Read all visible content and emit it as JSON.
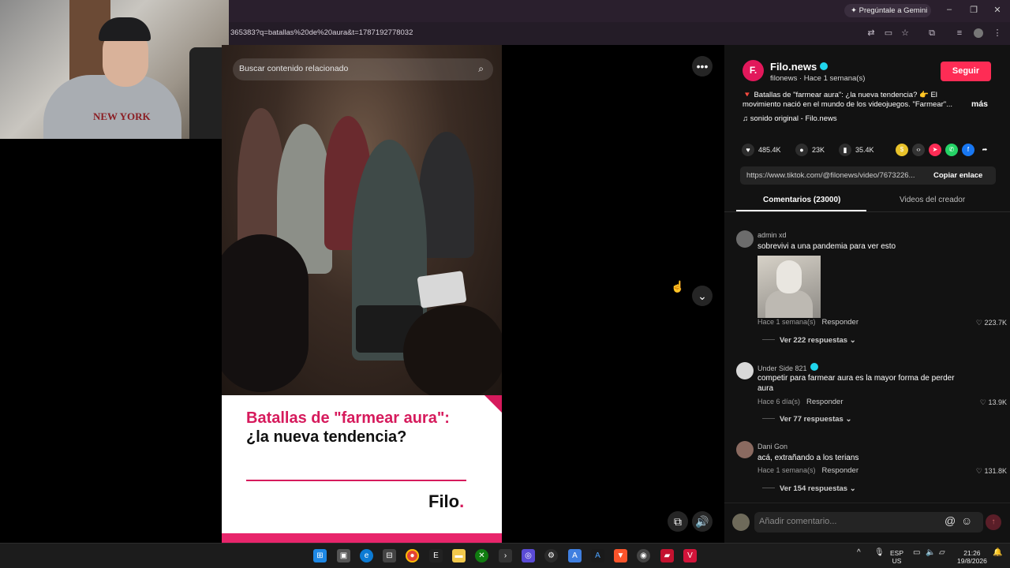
{
  "browser": {
    "url": "365383?q=batallas%20de%20aura&t=1787192778032",
    "gemini_label": "Pregúntale a Gemini"
  },
  "webcam": {
    "hoodie_text": "NEW YORK"
  },
  "video": {
    "search_placeholder": "Buscar contenido relacionado",
    "card_title_pink": "Batallas de \"farmear aura\":",
    "card_title_dark": " ¿la nueva tendencia?",
    "card_logo": "Filo",
    "card_logo_dot": "."
  },
  "post": {
    "avatar_letter": "F.",
    "author": "Filo.news",
    "handle": "filonews · Hace 1 semana(s)",
    "follow": "Seguir",
    "description": "🔻 Batallas de \"farmear aura\": ¿la nueva tendencia? 👉 El movimiento nació en el mundo de los videojuegos. \"Farmear\"...",
    "more": "más",
    "sound": "sonido original - Filo.news",
    "likes": "485.4K",
    "comments_count": "23K",
    "saves": "35.4K",
    "link": "https://www.tiktok.com/@filonews/video/7673226...",
    "copy_link": "Copiar enlace"
  },
  "tabs": {
    "comments": "Comentarios (23000)",
    "creator_videos": "Videos del creador"
  },
  "comments": [
    {
      "user": "admin xd",
      "text": "sobrevivi a una pandemia para ver esto",
      "time": "Hace 1 semana(s)",
      "reply": "Responder",
      "likes": "223.7K",
      "replies": "Ver 222 respuestas"
    },
    {
      "user": "Under Side 821",
      "text": "competir para farmear aura es la mayor forma de perder aura",
      "time": "Hace 6 día(s)",
      "reply": "Responder",
      "likes": "13.9K",
      "replies": "Ver 77 respuestas"
    },
    {
      "user": "Dani Gon",
      "text": "acá, extrañando a los terians",
      "time": "Hace 1 semana(s)",
      "reply": "Responder",
      "likes": "131.8K",
      "replies": "Ver 154 respuestas"
    }
  ],
  "comment_input": {
    "placeholder": "Añadir comentario..."
  },
  "taskbar": {
    "lang_top": "ESP",
    "lang_bottom": "US",
    "time": "21:26",
    "date": "19/8/2026"
  },
  "colors": {
    "accent": "#fe2c55",
    "filo_pink": "#d61a5c"
  }
}
